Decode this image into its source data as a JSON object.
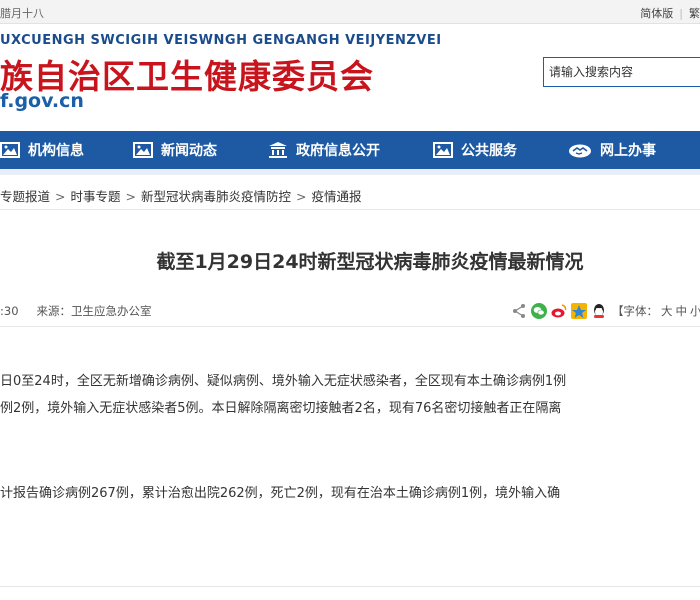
{
  "topbar": {
    "date": "腊月十八",
    "lang_simplified": "简体版",
    "lang_traditional": "繁"
  },
  "header": {
    "title_en": "UXCUENGH SWCIGIH VEISWNGH GENGANGH VEIJYENZVEI",
    "title_cn": "族自治区卫生健康委员会",
    "domain": "f.gov.cn"
  },
  "search": {
    "placeholder": "请输入搜索内容"
  },
  "nav": {
    "items": [
      {
        "label": "机构信息",
        "icon": "image-icon"
      },
      {
        "label": "新闻动态",
        "icon": "image-icon"
      },
      {
        "label": "政府信息公开",
        "icon": "building-icon"
      },
      {
        "label": "公共服务",
        "icon": "image-icon"
      },
      {
        "label": "网上办事",
        "icon": "handshake-icon"
      }
    ]
  },
  "breadcrumb": {
    "items": [
      "专题报道",
      "时事专题",
      "新型冠状病毒肺炎疫情防控",
      "疫情通报"
    ]
  },
  "article": {
    "title": "截至1月29日24时新型冠状病毒肺炎疫情最新情况",
    "time": ":30",
    "source_label": "来源：",
    "source": "卫生应急办公室",
    "font_label": "【字体：",
    "font_large": "大",
    "font_medium": "中",
    "font_small": "小】",
    "paragraphs": [
      "日0至24时，全区无新增确诊病例、疑似病例、境外输入无症状感染者，全区现有本土确诊病例1例",
      "例2例，境外输入无症状感染者5例。本日解除隔离密切接触者2名，现有76名密切接触者正在隔离",
      "计报告确诊病例267例，累计治愈出院262例，死亡2例，现有在治本土确诊病例1例，境外输入确"
    ]
  },
  "colors": {
    "brand_red": "#c8141c",
    "nav_blue": "#1d5aa3"
  }
}
